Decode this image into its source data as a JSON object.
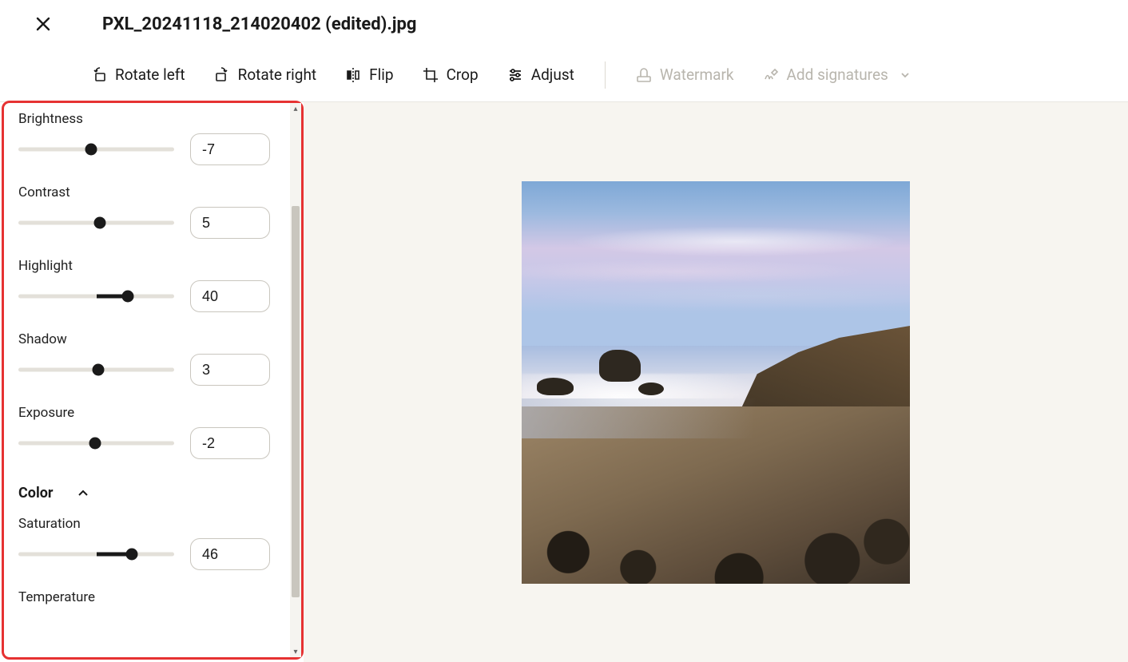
{
  "header": {
    "filename": "PXL_20241118_214020402 (edited).jpg"
  },
  "toolbar": {
    "rotate_left": "Rotate left",
    "rotate_right": "Rotate right",
    "flip": "Flip",
    "crop": "Crop",
    "adjust": "Adjust",
    "watermark": "Watermark",
    "add_signatures": "Add signatures"
  },
  "adjust": {
    "items": [
      {
        "label": "Brightness",
        "value": "-7",
        "min": -100,
        "max": 100
      },
      {
        "label": "Contrast",
        "value": "5",
        "min": -100,
        "max": 100
      },
      {
        "label": "Highlight",
        "value": "40",
        "min": -100,
        "max": 100
      },
      {
        "label": "Shadow",
        "value": "3",
        "min": -100,
        "max": 100
      },
      {
        "label": "Exposure",
        "value": "-2",
        "min": -100,
        "max": 100
      }
    ],
    "color_section": {
      "title": "Color"
    },
    "color_items": [
      {
        "label": "Saturation",
        "value": "46",
        "min": -100,
        "max": 100
      },
      {
        "label": "Temperature",
        "value": "",
        "min": -100,
        "max": 100
      }
    ]
  }
}
